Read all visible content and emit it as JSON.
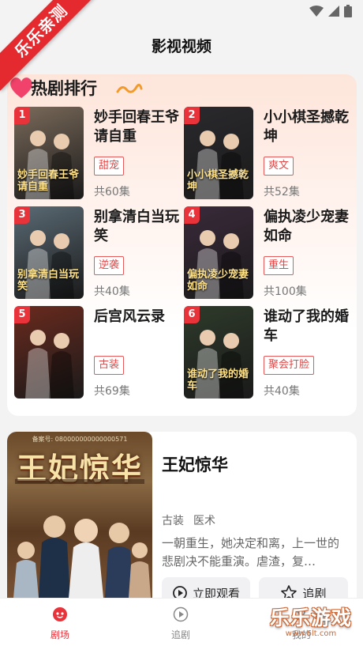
{
  "badge": "乐乐亲测",
  "header": {
    "title": "影视视频"
  },
  "hot": {
    "title": "热剧排行",
    "items": [
      {
        "rank": "1",
        "title": "妙手回春王爷请自重",
        "tag": "甜宠",
        "episodes": "共60集",
        "cover_text": "妙手回春王爷请自重",
        "cover_color": "#7a6a5a"
      },
      {
        "rank": "2",
        "title": "小小棋圣撼乾坤",
        "tag": "爽文",
        "episodes": "共52集",
        "cover_text": "小小棋圣撼乾坤",
        "cover_color": "#2a2a2e"
      },
      {
        "rank": "3",
        "title": "别拿清白当玩笑",
        "tag": "逆袭",
        "episodes": "共40集",
        "cover_text": "别拿清白当玩笑",
        "cover_color": "#5a6a74"
      },
      {
        "rank": "4",
        "title": "偏执凌少宠妻如命",
        "tag": "重生",
        "episodes": "共100集",
        "cover_text": "偏执凌少宠妻如命",
        "cover_color": "#3a2a3a"
      },
      {
        "rank": "5",
        "title": "后宫风云录",
        "tag": "古装",
        "episodes": "共69集",
        "cover_text": "",
        "cover_color": "#6a2a1e"
      },
      {
        "rank": "6",
        "title": "谁动了我的婚车",
        "tag": "聚会打脸",
        "episodes": "共40集",
        "cover_text": "谁动了我的婚车",
        "cover_color": "#2e3a2a"
      }
    ]
  },
  "feature": {
    "poster_id": "备案号: 080000000000000571",
    "poster_title": "王妃惊华",
    "title": "王妃惊华",
    "tags": [
      "古装",
      "医术"
    ],
    "description": "一朝重生，她决定和离，上一世的悲剧决不能重演。虐渣，复…",
    "watch_label": "立即观看",
    "follow_label": "追剧"
  },
  "tabs": [
    {
      "label": "剧场",
      "active": true
    },
    {
      "label": "追剧",
      "active": false
    },
    {
      "label": "我的",
      "active": false
    }
  ],
  "watermark": {
    "text": "乐乐游戏",
    "url": "www.6lt.com"
  },
  "colors": {
    "accent": "#e8333b",
    "tag_border": "#e85a5a"
  }
}
